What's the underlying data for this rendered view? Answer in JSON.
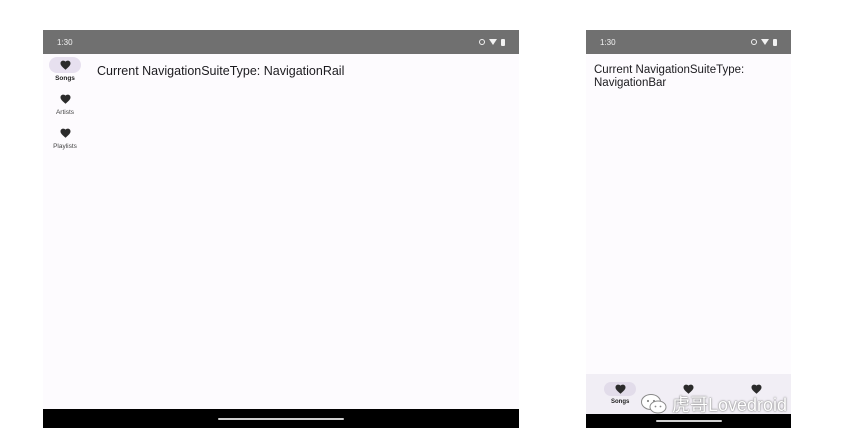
{
  "left_device": {
    "status_bar": {
      "time": "1:30"
    },
    "nav_rail": {
      "items": [
        {
          "label": "Songs",
          "icon": "heart-icon",
          "selected": true
        },
        {
          "label": "Artists",
          "icon": "heart-icon",
          "selected": false
        },
        {
          "label": "Playlists",
          "icon": "heart-icon",
          "selected": false
        }
      ]
    },
    "content_text": "Current NavigationSuiteType: NavigationRail"
  },
  "right_device": {
    "status_bar": {
      "time": "1:30"
    },
    "content_text": "Current NavigationSuiteType: NavigationBar",
    "nav_bar": {
      "items": [
        {
          "label": "Songs",
          "icon": "heart-icon",
          "selected": true
        },
        {
          "label": "",
          "icon": "heart-icon",
          "selected": false
        },
        {
          "label": "",
          "icon": "heart-icon",
          "selected": false
        }
      ]
    }
  },
  "watermark": {
    "text": "虎哥Lovedroid",
    "icon": "wechat-icon"
  },
  "colors": {
    "status_bar": "#707070",
    "surface": "#fdfbfe",
    "indicator": "#e7e0ef",
    "nav_bar": "#f1eef5",
    "gesture_area": "#000000"
  }
}
